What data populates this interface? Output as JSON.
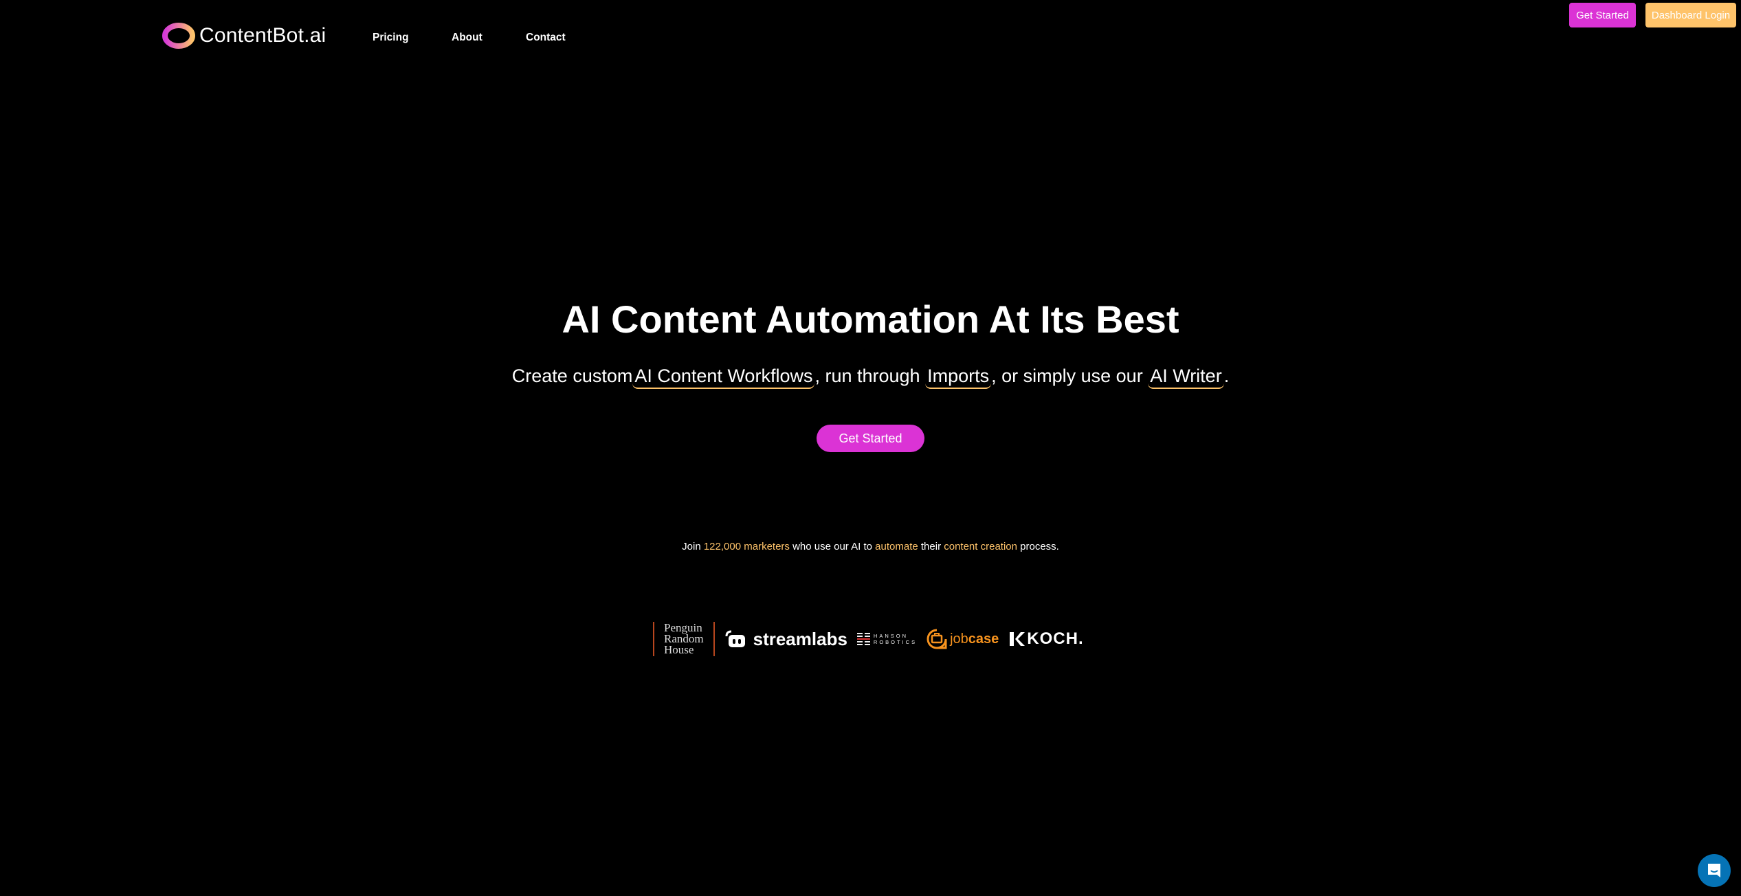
{
  "header": {
    "logo_text": "ContentBot.ai",
    "nav": [
      {
        "label": "Pricing"
      },
      {
        "label": "About"
      },
      {
        "label": "Contact"
      }
    ],
    "get_started_label": "Get Started",
    "dashboard_login_label": "Dashboard Login"
  },
  "hero": {
    "title": "AI Content Automation At Its Best",
    "subtitle": {
      "part1": "Create custom",
      "highlight1": "AI Content Workflows",
      "part2": ", run through ",
      "highlight2": "Imports",
      "part3": ", or simply use our ",
      "highlight3": "AI Writer",
      "part4": "."
    },
    "cta_label": "Get Started"
  },
  "social_proof": {
    "join": "Join ",
    "count": "122,000",
    "marketers": "marketers",
    "mid": " who use our AI to ",
    "automate": "automate",
    "their": " their ",
    "content_creation": "content creation",
    "end": " process."
  },
  "client_logos": {
    "penguin": [
      "Penguin",
      "Random",
      "House"
    ],
    "streamlabs": "streamlabs",
    "hanson": [
      "HANSON",
      "ROBOTICS"
    ],
    "jobcase_prefix": "job",
    "jobcase_suffix": "case",
    "koch": "KOCH."
  },
  "colors": {
    "brand_magenta": "#db33d5",
    "brand_orange": "#fec36a",
    "chat_blue": "#0573b6"
  }
}
